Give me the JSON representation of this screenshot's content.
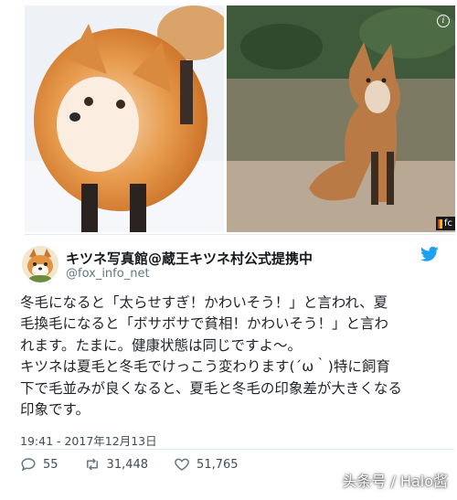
{
  "colors": {
    "twitter_blue": "#1da1f2",
    "handle_gray": "#657786",
    "text": "#1f2328",
    "divider": "#e1e8ed"
  },
  "photos": {
    "left_alt": "fox-winter-fur-photo",
    "right_alt": "fox-summer-fur-photo",
    "badge_text": "fc"
  },
  "tweet": {
    "display_name": "キツネ写真館@蔵王キツネ村公式提携中",
    "handle": "@fox_info_net",
    "lines": [
      "冬毛になると「太らせすぎ！かわいそう！」と言われ、夏",
      "毛換毛になると「ボサボサで貧相！かわいそう！」と言わ",
      "れます。たまに。健康状態は同じですよ〜。",
      "キツネは夏毛と冬毛でけっこう変わります(´ω｀)特に飼育",
      "下で毛並みが良くなると、夏毛と冬毛の印象差が大きくなる",
      "印象です。"
    ],
    "timestamp": "19:41 - 2017年12月13日",
    "replies": "55",
    "retweets": "31,448",
    "likes": "51,765"
  },
  "icons": {
    "brand": "twitter-bird-icon",
    "reply": "reply-icon",
    "retweet": "retweet-icon",
    "like": "heart-icon",
    "info": "info-icon"
  },
  "watermark": "头条号 / Halo酱"
}
